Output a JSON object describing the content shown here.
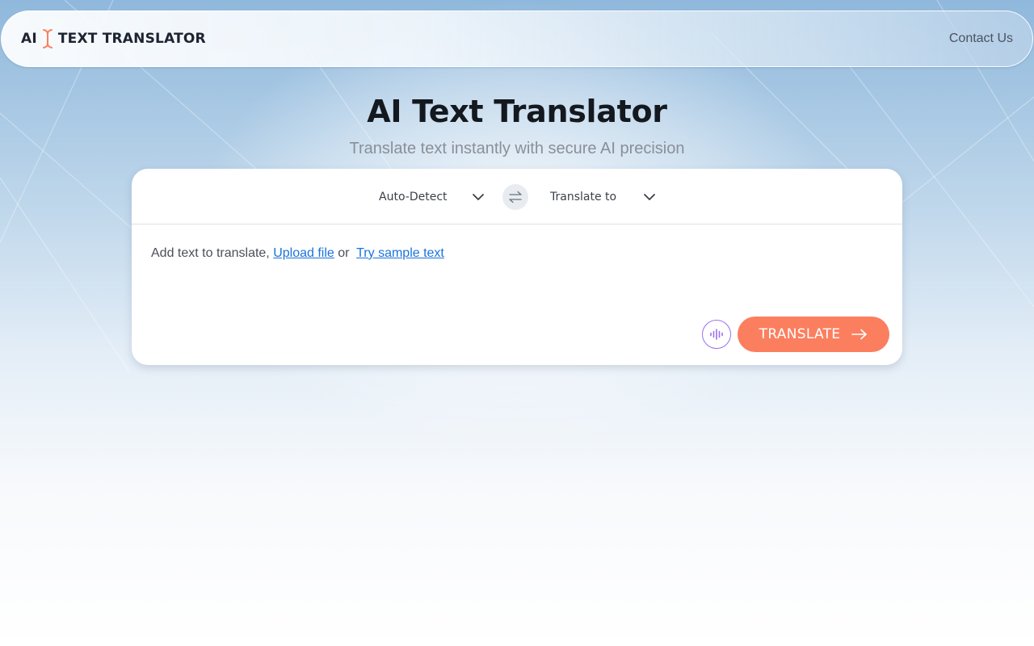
{
  "header": {
    "logo_left": "AI",
    "logo_right": "TEXT TRANSLATOR",
    "contact_label": "Contact Us"
  },
  "hero": {
    "title": "AI Text Translator",
    "subtitle": "Translate text instantly with secure AI precision"
  },
  "translator": {
    "source_language": "Auto-Detect",
    "target_language": "Translate to",
    "input_prefix": "Add text to translate,",
    "upload_link": "Upload file",
    "or_text": "or",
    "sample_link": "Try sample text",
    "translate_label": "TRANSLATE"
  },
  "icons": {
    "logo": "text-cursor-icon",
    "chevron": "chevron-down-icon",
    "swap": "swap-arrows-icon",
    "voice": "voice-waveform-icon",
    "arrow": "arrow-right-icon"
  },
  "colors": {
    "accent": "#fb7f5f",
    "link": "#1a73d9",
    "voice": "#9b6ef2"
  }
}
